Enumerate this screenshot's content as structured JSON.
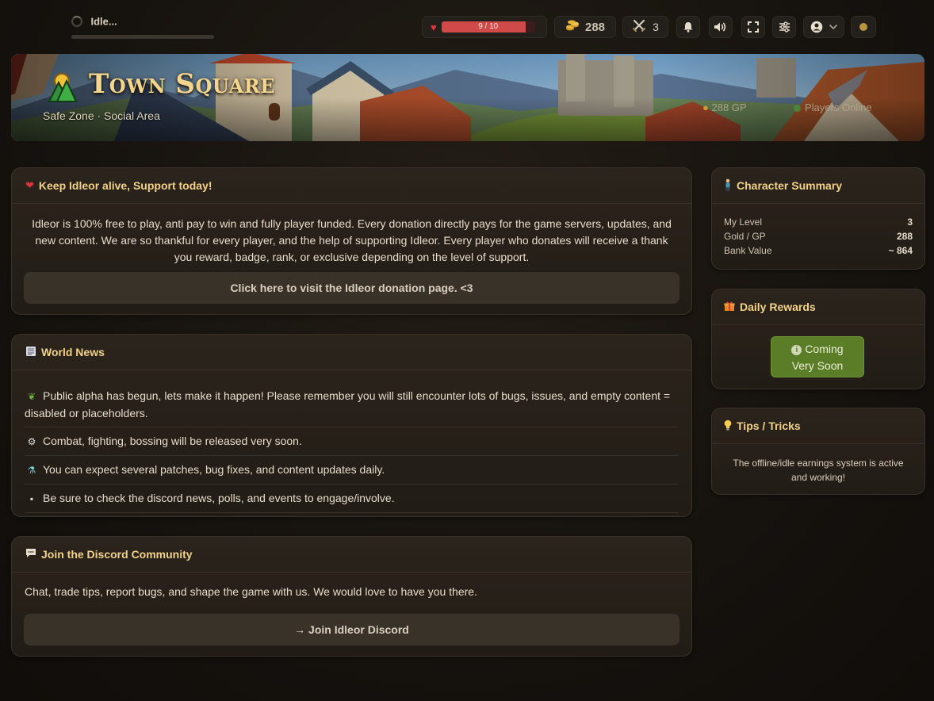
{
  "status": {
    "text": "Idle..."
  },
  "hud": {
    "hp_label": "9 / 10",
    "hp_fraction": 0.9,
    "gold": "288",
    "combat_level": "3"
  },
  "hero": {
    "title": "Town Square",
    "subtitle": "Safe Zone · Social Area",
    "gp": "288 GP",
    "online": "Players Online"
  },
  "support": {
    "title": "Keep Idleor alive, Support today!",
    "body": "Idleor is 100% free to play, anti pay to win and fully player funded. Every donation directly pays for the game servers, updates, and new content. We are so thankful for every player, and the help of supporting Idleor. Every player who donates will receive a thank you reward, badge, rank, or exclusive depending on the level of support.",
    "button": "Click here to visit the Idleor donation page. <3"
  },
  "news": {
    "title": "World News",
    "items": [
      {
        "icon": "seedling-icon",
        "text": "Public alpha has begun, lets make it happen! Please remember you will still encounter lots of bugs, issues, and empty content = disabled or placeholders."
      },
      {
        "icon": "gear-icon",
        "text": "Combat, fighting, bossing will be released very soon."
      },
      {
        "icon": "test-tube-icon",
        "text": "You can expect several patches, bug fixes, and content updates daily."
      },
      {
        "icon": "speech-bubble-icon",
        "text": "Be sure to check the discord news, polls, and events to engage/involve."
      }
    ]
  },
  "discord": {
    "title": "Join the Discord Community",
    "desc": "Chat, trade tips, report bugs, and shape the game with us. We would love to have you there.",
    "button": "→ Join Idleor Discord"
  },
  "summary": {
    "title": "Character Summary",
    "rows": [
      {
        "label": "My Level",
        "value": "3"
      },
      {
        "label": "Gold / GP",
        "value": "288"
      },
      {
        "label": "Bank Value",
        "value": "~ 864"
      }
    ]
  },
  "daily": {
    "title": "Daily Rewards",
    "line1": "Coming",
    "line2": "Very Soon"
  },
  "tips": {
    "title": "Tips / Tricks",
    "text": "The offline/idle earnings system is active and working!"
  },
  "colors": {
    "accent": "#f2d289",
    "hp": "#d14a4a",
    "success": "#5b7d27"
  }
}
